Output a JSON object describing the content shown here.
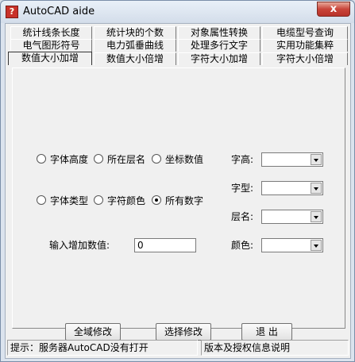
{
  "window": {
    "title": "AutoCAD aide",
    "app_icon": "?",
    "close_label": "x"
  },
  "tabs": {
    "row1": [
      "统计线条长度",
      "统计块的个数",
      "对象属性转换",
      "电缆型号查询"
    ],
    "row2": [
      "电气图形符号",
      "电力弧垂曲线",
      "处理多行文字",
      "实用功能集粹"
    ],
    "row3": [
      "数值大小加增",
      "数值大小倍增",
      "字符大小加增",
      "字符大小倍增"
    ],
    "active": "数值大小加增"
  },
  "options": {
    "row1": [
      {
        "label": "字体高度",
        "selected": false
      },
      {
        "label": "所在层名",
        "selected": false
      },
      {
        "label": "坐标数值",
        "selected": false
      }
    ],
    "row2": [
      {
        "label": "字体类型",
        "selected": false
      },
      {
        "label": "字符颜色",
        "selected": false
      },
      {
        "label": "所有数字",
        "selected": true
      }
    ]
  },
  "filters": {
    "height_label": "字高:",
    "style_label": "字型:",
    "layer_label": "层名:",
    "color_label": "颜色:",
    "height_value": "",
    "style_value": "",
    "layer_value": "",
    "color_value": ""
  },
  "increment": {
    "label": "输入增加数值:",
    "value": "0"
  },
  "buttons": {
    "modify_all": "全域修改",
    "modify_selected": "选择修改",
    "exit": "退  出"
  },
  "status": {
    "left": "提示：服务器AutoCAD没有打开",
    "right": "版本及授权信息说明"
  }
}
